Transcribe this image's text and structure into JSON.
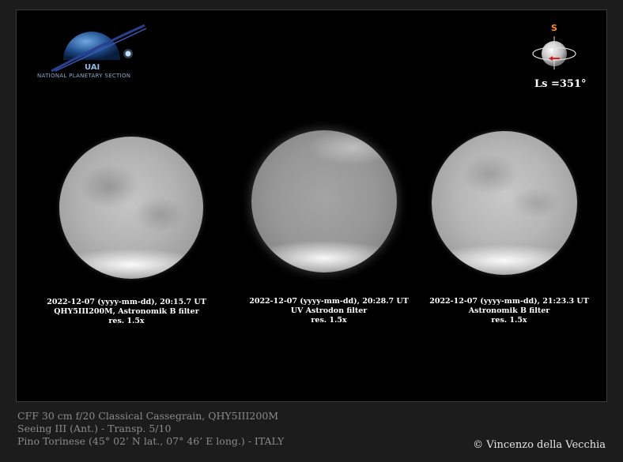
{
  "logo": {
    "acronym": "UAI",
    "section": "NATIONAL PLANETARY SECTION"
  },
  "orientation": {
    "south_label": "S",
    "ls_label": "Ls =351°"
  },
  "images": [
    {
      "date_time": "2022-12-07 (yyyy-mm-dd), 20:15.7 UT",
      "camera_filter": "QHY5III200M, Astronomik B filter",
      "resolution": "res. 1.5x"
    },
    {
      "date_time": "2022-12-07 (yyyy-mm-dd), 20:28.7 UT",
      "camera_filter": "UV Astrodon filter",
      "resolution": "res. 1.5x"
    },
    {
      "date_time": "2022-12-07 (yyyy-mm-dd), 21:23.3 UT",
      "camera_filter": "Astronomik B filter",
      "resolution": "res. 1.5x"
    }
  ],
  "footer": {
    "telescope": "CFF 30 cm f/20 Classical Cassegrain, QHY5III200M",
    "seeing": "Seeing  III (Ant.) - Transp. 5/10",
    "location": "Pino Torinese (45° 02’ N lat., 07° 46’ E long.) - ITALY",
    "credit": "© Vincenzo della Vecchia"
  },
  "colors": {
    "background": "#000000",
    "page_border": "#1c1c1c",
    "caption_text": "#ffffff",
    "footer_text": "#8a8a8a",
    "south_marker": "#ff8c1a",
    "arrow": "#d42020"
  }
}
